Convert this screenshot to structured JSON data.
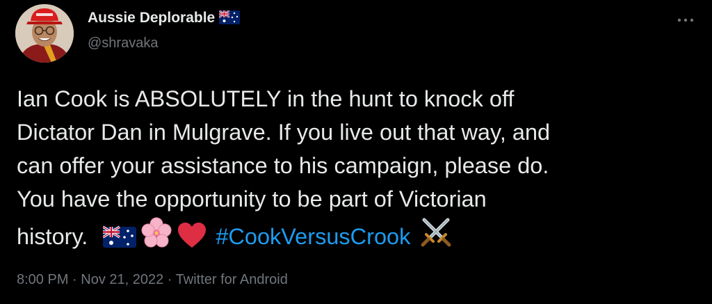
{
  "author": {
    "display_name": "Aussie Deplorable",
    "handle": "@shravaka",
    "flag_icon": "australian-flag-icon",
    "avatar_icon": "profile-avatar"
  },
  "tweet": {
    "lines": [
      "Ian Cook is ABSOLUTELY in the hunt to knock off",
      "Dictator Dan in Mulgrave. If you live out that way, and",
      "can offer your assistance to his campaign, please do.",
      "You have the opportunity to be part of Victorian",
      "history."
    ],
    "hashtag": "#CookVersusCrook",
    "emojis": [
      "australian-flag-icon",
      "cherry-blossom-icon",
      "red-heart-icon",
      "crossed-swords-icon"
    ]
  },
  "meta": {
    "text": "8:00 PM · Nov 21, 2022 · Twitter for Android"
  },
  "colors": {
    "background": "#000000",
    "text": "#e7e9ea",
    "secondary": "#71767b",
    "link": "#1d9bf0"
  }
}
